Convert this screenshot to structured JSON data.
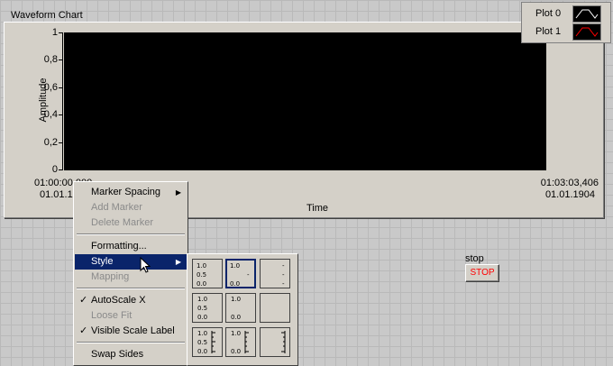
{
  "chart": {
    "title": "Waveform Chart",
    "y_axis_label": "Amplitude",
    "x_axis_label": "Time",
    "y_ticks": [
      "1",
      "0,8",
      "0,6",
      "0,4",
      "0,2",
      "0"
    ],
    "x_start_time": "01:00:00,000",
    "x_start_date": "01.01.1",
    "x_end_time": "01:03:03,406",
    "x_end_date": "01.01.1904",
    "plot_background": "#000000"
  },
  "legend": {
    "items": [
      {
        "label": "Plot 0",
        "color": "#ffffff"
      },
      {
        "label": "Plot 1",
        "color": "#ff0000"
      }
    ]
  },
  "stop_control": {
    "label": "stop",
    "button_text": "STOP",
    "button_text_color": "#ff0000"
  },
  "context_menu": {
    "items": [
      {
        "label": "Marker Spacing",
        "enabled": true,
        "submenu": true
      },
      {
        "label": "Add Marker",
        "enabled": false
      },
      {
        "label": "Delete Marker",
        "enabled": false
      },
      {
        "label": "Formatting...",
        "enabled": true
      },
      {
        "label": "Style",
        "enabled": true,
        "submenu": true,
        "selected": true
      },
      {
        "label": "Mapping",
        "enabled": false
      },
      {
        "label": "AutoScale X",
        "enabled": true,
        "checked": true
      },
      {
        "label": "Loose Fit",
        "enabled": false
      },
      {
        "label": "Visible Scale Label",
        "enabled": true,
        "checked": true
      },
      {
        "label": "Swap Sides",
        "enabled": true
      }
    ],
    "selection_color": "#0a246a"
  },
  "style_submenu": {
    "cells": [
      {
        "labels": [
          "1.0",
          "0.5",
          "0.0"
        ]
      },
      {
        "labels": [
          "1.0",
          "-",
          "0.0"
        ],
        "selected": true
      },
      {
        "labels": [
          "-",
          "-",
          "-"
        ]
      },
      {
        "labels": [
          "1.0",
          "0.5",
          "0.0"
        ]
      },
      {
        "labels": [
          "1.0",
          "0.0"
        ]
      },
      {
        "labels": []
      },
      {
        "labels": [
          "1.0",
          "0.5",
          "0.0"
        ]
      },
      {
        "labels": [
          "1.0",
          "0.0"
        ]
      },
      {
        "labels": []
      }
    ]
  }
}
